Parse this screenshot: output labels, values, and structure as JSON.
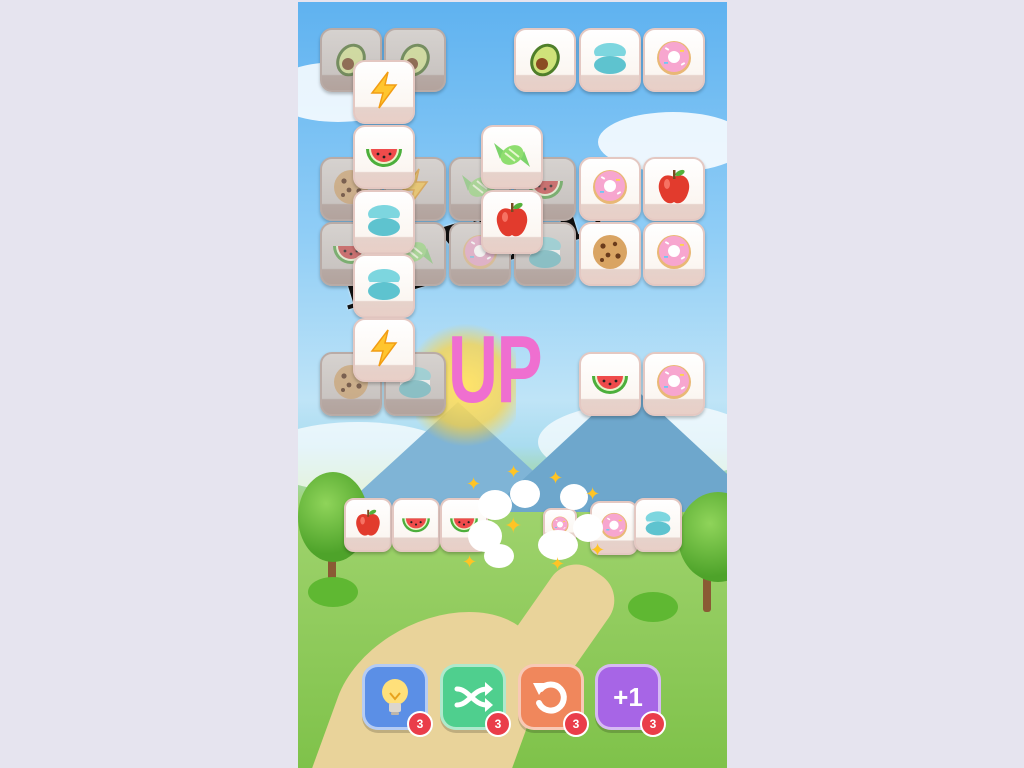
{
  "overlay": {
    "level_text": "LEVEL",
    "up_text": "UP"
  },
  "icons": {
    "avocado": "avocado-icon",
    "macaron": "macaron-icon",
    "donut": "donut-icon",
    "lightning": "lightning-icon",
    "watermelon": "watermelon-icon",
    "candy": "candy-icon",
    "apple": "apple-icon",
    "cookie": "cookie-icon"
  },
  "board_tiles": [
    {
      "icon": "avocado",
      "layer": "under"
    },
    {
      "icon": "avocado",
      "layer": "under"
    },
    {
      "icon": "avocado",
      "layer": "top"
    },
    {
      "icon": "macaron",
      "layer": "top"
    },
    {
      "icon": "donut",
      "layer": "top"
    },
    {
      "icon": "lightning",
      "layer": "top"
    },
    {
      "icon": "cookie",
      "layer": "under"
    },
    {
      "icon": "lightning",
      "layer": "under"
    },
    {
      "icon": "candy",
      "layer": "under"
    },
    {
      "icon": "watermelon",
      "layer": "under"
    },
    {
      "icon": "watermelon",
      "layer": "top"
    },
    {
      "icon": "candy",
      "layer": "top"
    },
    {
      "icon": "donut",
      "layer": "top"
    },
    {
      "icon": "apple",
      "layer": "top"
    },
    {
      "icon": "watermelon",
      "layer": "under"
    },
    {
      "icon": "candy",
      "layer": "under"
    },
    {
      "icon": "donut",
      "layer": "under"
    },
    {
      "icon": "macaron",
      "layer": "under"
    },
    {
      "icon": "macaron",
      "layer": "top"
    },
    {
      "icon": "apple",
      "layer": "top"
    },
    {
      "icon": "cookie",
      "layer": "top"
    },
    {
      "icon": "donut",
      "layer": "top"
    },
    {
      "icon": "macaron",
      "layer": "top"
    },
    {
      "icon": "cookie",
      "layer": "under"
    },
    {
      "icon": "macaron",
      "layer": "under"
    },
    {
      "icon": "lightning",
      "layer": "top"
    },
    {
      "icon": "watermelon",
      "layer": "top"
    },
    {
      "icon": "donut",
      "layer": "top"
    }
  ],
  "tray_tiles": [
    {
      "icon": "apple"
    },
    {
      "icon": "watermelon"
    },
    {
      "icon": "watermelon"
    },
    {
      "icon": "donut"
    },
    {
      "icon": "donut"
    },
    {
      "icon": "macaron"
    }
  ],
  "boosters": [
    {
      "name": "hint",
      "icon": "lightbulb-icon",
      "count": "3",
      "color": "#5b8fe6"
    },
    {
      "name": "shuffle",
      "icon": "shuffle-icon",
      "count": "3",
      "color": "#4fcf8e"
    },
    {
      "name": "undo",
      "icon": "undo-icon",
      "count": "3",
      "color": "#f0875c"
    },
    {
      "name": "plus-one",
      "icon": "plus-one-icon",
      "count": "3",
      "color": "#a765e6",
      "label": "+1"
    }
  ]
}
